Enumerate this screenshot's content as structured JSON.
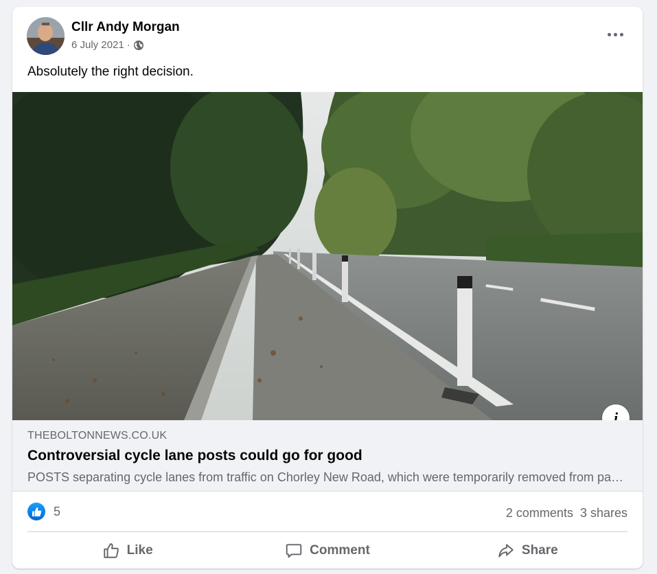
{
  "post": {
    "author": "Cllr Andy Morgan",
    "date": "6 July 2021",
    "date_separator": "·",
    "privacy_icon": "globe-icon",
    "text": "Absolutely the right decision."
  },
  "link_preview": {
    "domain": "THEBOLTONNEWS.CO.UK",
    "title": "Controversial cycle lane posts could go for good",
    "description": "POSTS separating cycle lanes from traffic on Chorley New Road, which were temporarily removed from part of the route, could now be permanently removed."
  },
  "engagement": {
    "reaction_icon": "like-reaction-icon",
    "reaction_count": "5",
    "comments": "2 comments",
    "shares": "3 shares"
  },
  "actions": {
    "like": "Like",
    "comment": "Comment",
    "share": "Share"
  },
  "colors": {
    "accent": "#0866ff",
    "secondary_text": "#65676b",
    "background": "#f0f2f5"
  }
}
